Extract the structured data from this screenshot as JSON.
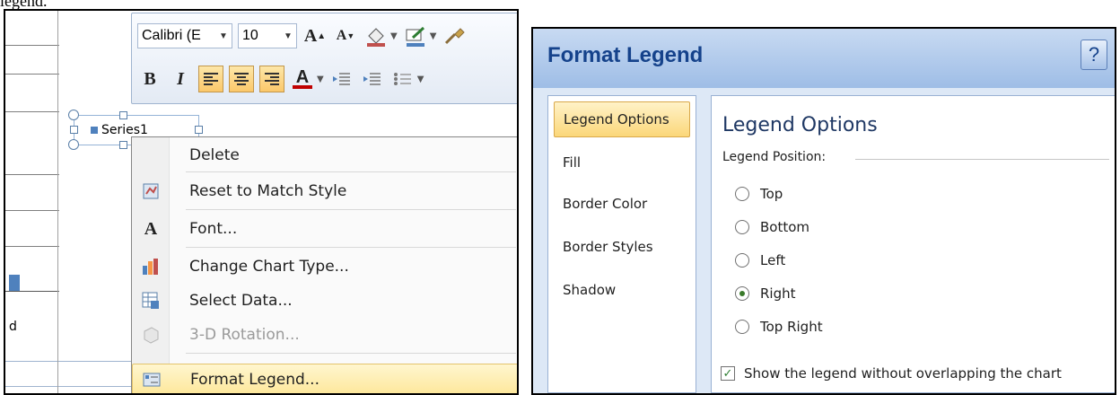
{
  "caption_fragment": "legend.",
  "context_view": {
    "legend_label": "Series1",
    "partial_text": "d",
    "mini_toolbar": {
      "font_name": "Calibri (E",
      "font_size": "10",
      "grow_font": "A",
      "shrink_font": "A",
      "bold": "B",
      "italic": "I",
      "font_color": "A"
    },
    "menu_items": [
      {
        "label": "Delete",
        "icon": "none",
        "enabled": true
      },
      {
        "label": "Reset to Match Style",
        "icon": "reset-style-icon",
        "enabled": true
      },
      {
        "label": "Font...",
        "icon": "font-icon",
        "enabled": true
      },
      {
        "label": "Change Chart Type...",
        "icon": "chart-type-icon",
        "enabled": true
      },
      {
        "label": "Select Data...",
        "icon": "select-data-icon",
        "enabled": true
      },
      {
        "label": "3-D Rotation...",
        "icon": "3d-rotation-icon",
        "enabled": false
      },
      {
        "label": "Format Legend...",
        "icon": "format-legend-icon",
        "enabled": true,
        "highlighted": true
      }
    ]
  },
  "dialog": {
    "title": "Format Legend",
    "help": "?",
    "nav": [
      "Legend Options",
      "Fill",
      "Border Color",
      "Border Styles",
      "Shadow"
    ],
    "selected_nav": "Legend Options",
    "section_title": "Legend Options",
    "group_label": "Legend Position:",
    "positions": [
      {
        "label": "Top",
        "selected": false
      },
      {
        "label": "Bottom",
        "selected": false
      },
      {
        "label": "Left",
        "selected": false
      },
      {
        "label": "Right",
        "selected": true
      },
      {
        "label": "Top Right",
        "selected": false
      }
    ],
    "no_overlap_checkbox": {
      "label": "Show the legend without overlapping the chart",
      "checked": true
    }
  },
  "colors": {
    "series_blue": "#4f81bd",
    "highlight_gold": "#fbd77a",
    "title_blue": "#15428b"
  }
}
